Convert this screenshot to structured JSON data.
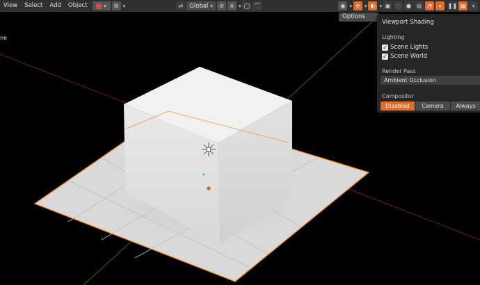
{
  "header": {
    "menu": [
      "View",
      "Select",
      "Add",
      "Object"
    ],
    "orientation": "Global"
  },
  "viewport": {
    "object_label": "ne",
    "options_label": "Options"
  },
  "popover": {
    "title": "Viewport Shading",
    "lighting_label": "Lighting",
    "scene_lights": {
      "label": "Scene Lights",
      "checked": true
    },
    "scene_world": {
      "label": "Scene World",
      "checked": true
    },
    "render_pass_label": "Render Pass",
    "render_pass_value": "Ambient Occlusion",
    "compositor_label": "Compositor",
    "compositor_options": [
      "Disabled",
      "Camera",
      "Always"
    ],
    "compositor_selected": "Disabled"
  },
  "colors": {
    "accent": "#e06b2b",
    "header_bg": "#303030",
    "popover_bg": "#262626",
    "x_axis": "#c0392b",
    "y_axis": "#2ecc71"
  }
}
